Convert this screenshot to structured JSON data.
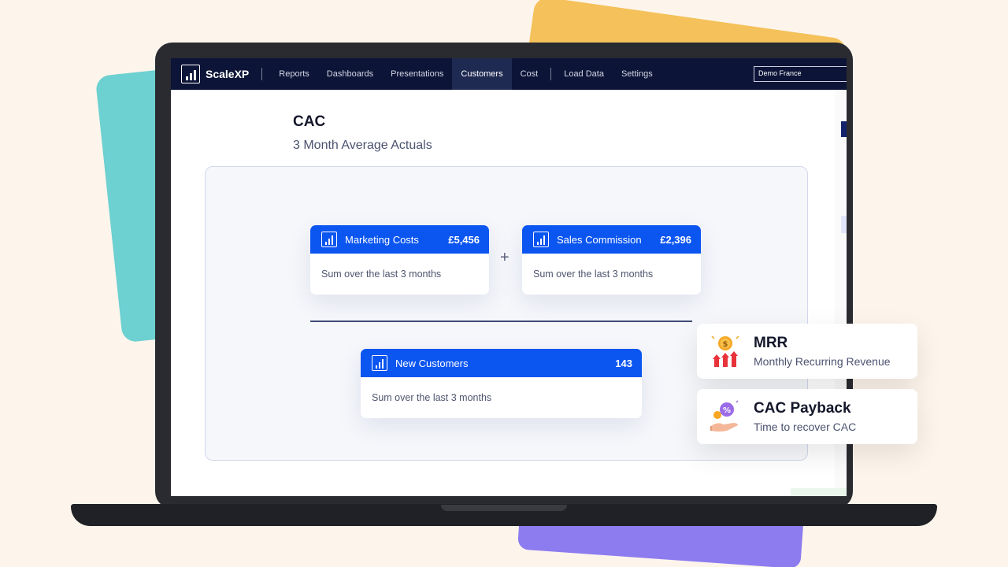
{
  "brand": {
    "name": "ScaleXP"
  },
  "nav": {
    "items": [
      "Reports",
      "Dashboards",
      "Presentations",
      "Customers",
      "Cost",
      "Load Data",
      "Settings"
    ],
    "active": "Customers",
    "org_select": "Demo France"
  },
  "page": {
    "title": "CAC",
    "subtitle": "3 Month Average Actuals"
  },
  "formula": {
    "operator": "+",
    "numerator": [
      {
        "label": "Marketing Costs",
        "value": "£5,456",
        "description": "Sum over the last 3 months"
      },
      {
        "label": "Sales Commission",
        "value": "£2,396",
        "description": "Sum over the last 3 months"
      }
    ],
    "denominator": {
      "label": "New Customers",
      "value": "143",
      "description": "Sum over the last 3 months"
    }
  },
  "feature_cards": [
    {
      "title": "MRR",
      "subtitle": "Monthly Recurring Revenue",
      "icon": "coin-growth-icon"
    },
    {
      "title": "CAC Payback",
      "subtitle": "Time to recover CAC",
      "icon": "hand-coin-percent-icon"
    }
  ],
  "colors": {
    "nav_bg": "#0c1437",
    "card_header": "#0b55f0",
    "page_bg": "#fdf5eb",
    "deco_teal": "#6dd0d1",
    "deco_yellow": "#f4c15a",
    "deco_purple": "#8d7cf0"
  }
}
